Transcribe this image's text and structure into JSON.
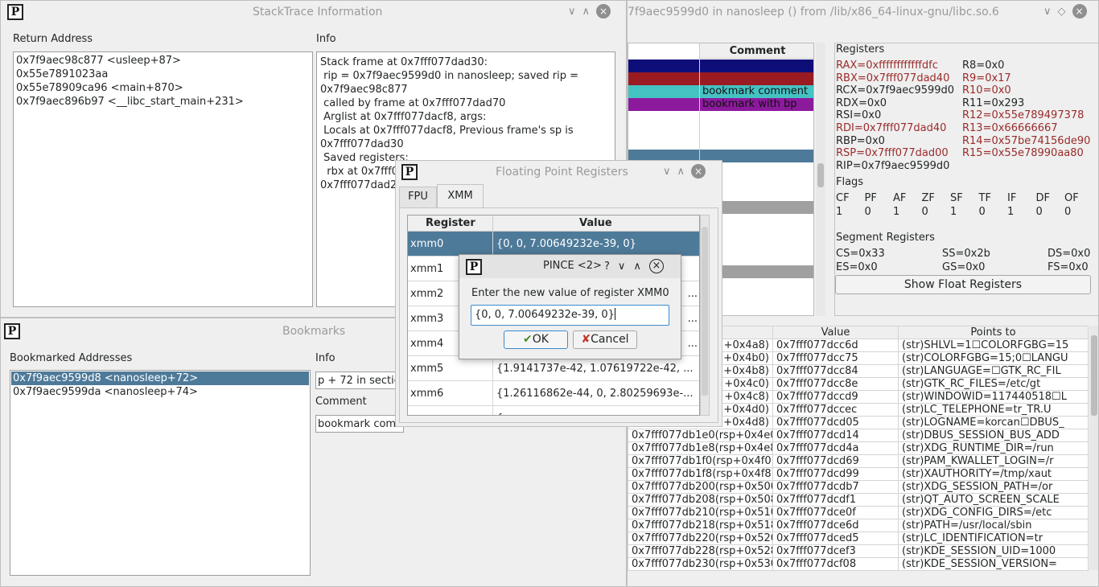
{
  "stacktrace": {
    "title": "StackTrace Information",
    "ret_header": "Return Address",
    "info_header": "Info",
    "returns": [
      "0x7f9aec98c877 <usleep+87>",
      "0x55e7891023aa",
      "0x55e78909ca96 <main+870>",
      "0x7f9aec896b97 <__libc_start_main+231>"
    ],
    "info_lines": [
      "Stack frame at 0x7fff077dad30:",
      " rip = 0x7f9aec9599d0 in nanosleep; saved rip =",
      "0x7f9aec98c877",
      " called by frame at 0x7fff077dad70",
      " Arglist at 0x7fff077dacf8, args:",
      " Locals at 0x7fff077dacf8, Previous frame's sp is",
      "0x7fff077dad30",
      " Saved registers:",
      "  rbx at 0x7fff0",
      "0x7fff077dad2"
    ]
  },
  "main": {
    "title": "7f9aec9599d0 in nanosleep () from /lib/x86_64-linux-gnu/libc.so.6",
    "comment_header": "Comment",
    "comments": [
      "",
      "",
      "bookmark comment",
      "bookmark with bp"
    ],
    "registers_header": "Registers",
    "regs_left": [
      "RAX=0xffffffffffffdfc",
      "RBX=0x7fff077dad40",
      "RCX=0x7f9aec9599d0",
      "RDX=0x0",
      "RSI=0x0",
      "RDI=0x7fff077dad40",
      "RBP=0x0",
      "RSP=0x7fff077dad00"
    ],
    "regs_right": [
      "R8=0x0",
      "R9=0x17",
      "R10=0x0",
      "R11=0x293",
      "R12=0x55e789497378",
      "R13=0x66666667",
      "R14=0x57be74156de90",
      "R15=0x55e78990aa80"
    ],
    "rip": "RIP=0x7f9aec9599d0",
    "flags_header": "Flags",
    "flag_names": [
      "CF",
      "PF",
      "AF",
      "ZF",
      "SF",
      "TF",
      "IF",
      "DF",
      "OF"
    ],
    "flag_values": [
      "1",
      "0",
      "1",
      "0",
      "1",
      "0",
      "1",
      "0",
      "0"
    ],
    "segment_header": "Segment Registers",
    "segments": [
      "CS=0x33",
      "SS=0x2b",
      "DS=0x0",
      "ES=0x0",
      "GS=0x0",
      "FS=0x0"
    ],
    "show_float_btn": "Show Float Registers",
    "stack_headers": [
      "Value",
      "Points to"
    ],
    "stack_rows": [
      [
        "+0x4a8)",
        "0x7fff077dcc6d",
        "(str)SHLVL=1☐COLORFGBG=15"
      ],
      [
        "+0x4b0)",
        "0x7fff077dcc75",
        "(str)COLORFGBG=15;0☐LANGU"
      ],
      [
        "+0x4b8)",
        "0x7fff077dcc84",
        "(str)LANGUAGE=☐GTK_RC_FIL"
      ],
      [
        "+0x4c0)",
        "0x7fff077dcc8e",
        "(str)GTK_RC_FILES=/etc/gt"
      ],
      [
        "+0x4c8)",
        "0x7fff077dccd9",
        "(str)WINDOWID=117440518☐L"
      ],
      [
        "+0x4d0)",
        "0x7fff077dccec",
        "(str)LC_TELEPHONE=tr_TR.U"
      ],
      [
        "+0x4d8)",
        "0x7fff077dcd05",
        "(str)LOGNAME=korcan☐DBUS_"
      ],
      [
        "0x7fff077db1e0(rsp+0x4e0)",
        "0x7fff077dcd14",
        "(str)DBUS_SESSION_BUS_ADD"
      ],
      [
        "0x7fff077db1e8(rsp+0x4e8)",
        "0x7fff077dcd4a",
        "(str)XDG_RUNTIME_DIR=/run"
      ],
      [
        "0x7fff077db1f0(rsp+0x4f0)",
        "0x7fff077dcd69",
        "(str)PAM_KWALLET_LOGIN=/r"
      ],
      [
        "0x7fff077db1f8(rsp+0x4f8)",
        "0x7fff077dcd99",
        "(str)XAUTHORITY=/tmp/xaut"
      ],
      [
        "0x7fff077db200(rsp+0x500)",
        "0x7fff077dcdb7",
        "(str)XDG_SESSION_PATH=/or"
      ],
      [
        "0x7fff077db208(rsp+0x508)",
        "0x7fff077dcdf1",
        "(str)QT_AUTO_SCREEN_SCALE"
      ],
      [
        "0x7fff077db210(rsp+0x510)",
        "0x7fff077dce0f",
        "(str)XDG_CONFIG_DIRS=/etc"
      ],
      [
        "0x7fff077db218(rsp+0x518)",
        "0x7fff077dce6d",
        "(str)PATH=/usr/local/sbin"
      ],
      [
        "0x7fff077db220(rsp+0x520)",
        "0x7fff077dced5",
        "(str)LC_IDENTIFICATION=tr"
      ],
      [
        "0x7fff077db228(rsp+0x528)",
        "0x7fff077dcef3",
        "(str)KDE_SESSION_UID=1000"
      ],
      [
        "0x7fff077db230(rsp+0x530)",
        "0x7fff077dcf08",
        "(str)KDE_SESSION_VERSION="
      ]
    ]
  },
  "bookmarks": {
    "title": "Bookmarks",
    "addr_header": "Bookmarked Addresses",
    "info_header": "Info",
    "items": [
      "0x7f9aec9599d8 <nanosleep+72>",
      "0x7f9aec9599da <nanosleep+74>"
    ],
    "info_value": "p + 72 in sectio",
    "comment_header": "Comment",
    "comment_value": "bookmark com"
  },
  "float": {
    "title": "Floating Point Registers",
    "tabs": [
      "FPU",
      "XMM"
    ],
    "headers": [
      "Register",
      "Value"
    ],
    "rows": [
      [
        "xmm0",
        "{0, 0, 7.00649232e-39, 0}"
      ],
      [
        "xmm1",
        ""
      ],
      [
        "xmm2",
        "..."
      ],
      [
        "xmm3",
        "..."
      ],
      [
        "xmm4",
        "..."
      ],
      [
        "xmm5",
        "{1.9141737e-42, 1.07619722e-42, ..."
      ],
      [
        "xmm6",
        "{1.26116862e-44, 0, 2.80259693e-..."
      ],
      [
        "",
        "{"
      ]
    ]
  },
  "dialog": {
    "title": "PINCE <2>",
    "prompt": "Enter the new value of register XMM0",
    "value": "{0, 0, 7.00649232e-39, 0}",
    "ok": "OK",
    "cancel": "Cancel",
    "help_glyph": "?",
    "min_glyph": "∨",
    "max_glyph": "∧",
    "close_glyph": "×"
  },
  "icons": {
    "logo_glyph": "P",
    "close_glyph": "×",
    "min_glyph": "∨",
    "max_glyph": "∧",
    "diamond_glyph": "◇"
  },
  "colors": {
    "selection": "#4e7a99",
    "navy_row": "#0e0e78",
    "maroon_row": "#9b1b22",
    "teal_row": "#45c2c2",
    "purple_row": "#8c1a9c",
    "red_register": "#9a2b2b"
  }
}
